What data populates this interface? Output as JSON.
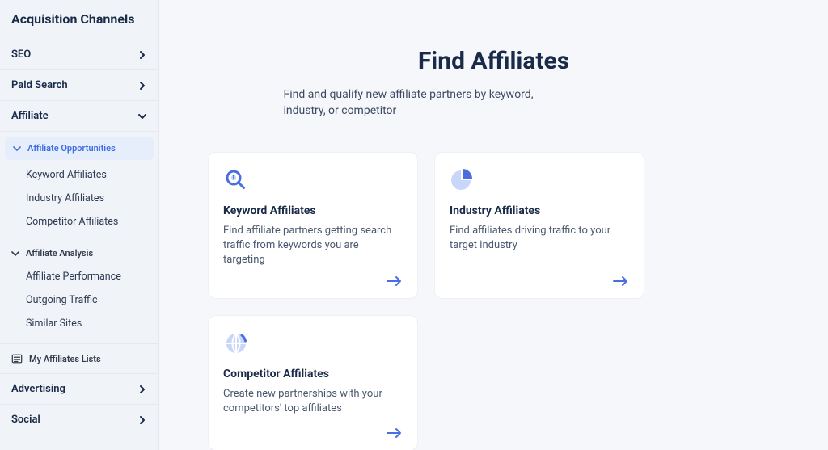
{
  "sidebar": {
    "title": "Acquisition Channels",
    "items": [
      {
        "label": "SEO"
      },
      {
        "label": "Paid Search"
      },
      {
        "label": "Affiliate",
        "expanded": true
      },
      {
        "label": "Advertising"
      },
      {
        "label": "Social"
      }
    ],
    "affiliate_sections": {
      "opportunities": {
        "header": "Affiliate Opportunities",
        "links": [
          {
            "label": "Keyword Affiliates"
          },
          {
            "label": "Industry Affiliates"
          },
          {
            "label": "Competitor Affiliates"
          }
        ]
      },
      "analysis": {
        "header": "Affiliate Analysis",
        "links": [
          {
            "label": "Affiliate Performance"
          },
          {
            "label": "Outgoing Traffic"
          },
          {
            "label": "Similar Sites"
          }
        ]
      },
      "my_lists": {
        "label": "My Affiliates Lists"
      }
    }
  },
  "hero": {
    "title": "Find Affiliates",
    "subtitle": "Find and qualify new affiliate partners by keyword, industry, or competitor"
  },
  "cards": [
    {
      "title": "Keyword Affiliates",
      "desc": "Find affiliate partners getting search traffic from keywords you are targeting",
      "icon": "magnify"
    },
    {
      "title": "Industry Affiliates",
      "desc": "Find affiliates driving traffic to your target industry",
      "icon": "pie"
    },
    {
      "title": "Competitor Affiliates",
      "desc": "Create new partnerships with your competitors' top affiliates",
      "icon": "globe"
    }
  ]
}
